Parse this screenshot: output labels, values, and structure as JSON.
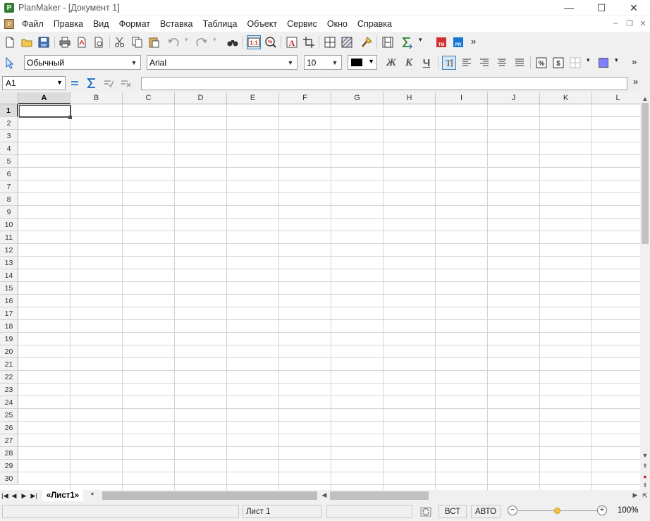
{
  "window": {
    "title": "PlanMaker - [Документ 1]",
    "app_icon": "P",
    "controls": {
      "minimize": "—",
      "maximize": "☐",
      "close": "✕"
    }
  },
  "menu": {
    "items": [
      "Файл",
      "Правка",
      "Вид",
      "Формат",
      "Вставка",
      "Таблица",
      "Объект",
      "Сервис",
      "Окно",
      "Справка"
    ],
    "mdi": {
      "minimize": "–",
      "restore": "❐",
      "close": "✕"
    }
  },
  "toolbar_format": {
    "style": "Обычный",
    "font": "Arial",
    "size": "10",
    "bold": "Ж",
    "italic": "К",
    "underline": "Ч",
    "text_color": "#000000",
    "fill_color": "#8080ff"
  },
  "formula_bar": {
    "cell_ref": "A1",
    "formula": ""
  },
  "grid": {
    "columns": [
      "A",
      "B",
      "C",
      "D",
      "E",
      "F",
      "G",
      "H",
      "I",
      "J",
      "K",
      "L"
    ],
    "rows": [
      "1",
      "2",
      "3",
      "4",
      "5",
      "6",
      "7",
      "8",
      "9",
      "10",
      "11",
      "12",
      "13",
      "14",
      "15",
      "16",
      "17",
      "18",
      "19",
      "20",
      "21",
      "22",
      "23",
      "24",
      "25",
      "26",
      "27",
      "28",
      "29",
      "30"
    ],
    "selected_column": "A",
    "selected_row": "1"
  },
  "sheets": {
    "tabs": [
      "«Лист1»"
    ],
    "new_tab": "*"
  },
  "status": {
    "sheet": "Лист 1",
    "insert_mode": "ВСТ",
    "calc_mode": "АВТО",
    "zoom": "100%",
    "zoom_level": 1.0
  }
}
